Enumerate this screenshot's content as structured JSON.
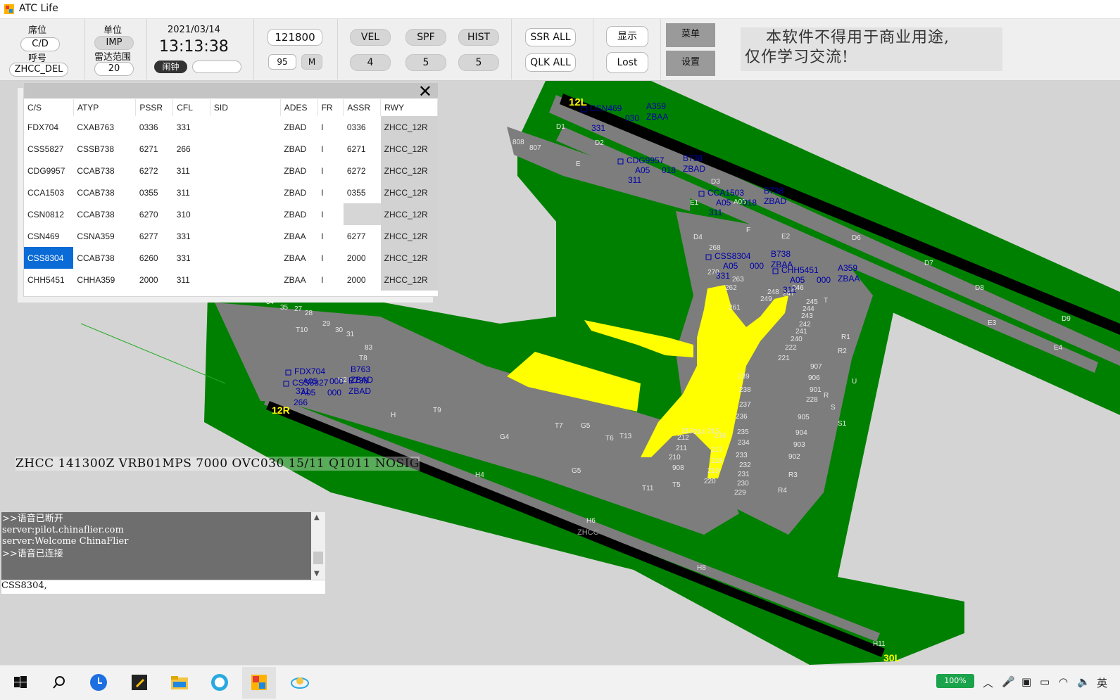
{
  "window": {
    "title": "ATC Life"
  },
  "toolbar": {
    "seat_label": "席位",
    "seat_value": "C/D",
    "callsign_label": "呼号",
    "callsign_value": "ZHCC_DEL",
    "unit_label": "单位",
    "unit_value": "IMP",
    "radar_range_label": "雷达范围",
    "radar_range_value": "20",
    "date": "2021/03/14",
    "time": "13:13:38",
    "alarm_label": "闹钟",
    "freq": "121800",
    "sub_value": "95",
    "m_label": "M",
    "vel_label": "VEL",
    "vel_value": "4",
    "spf_label": "SPF",
    "spf_value": "5",
    "hist_label": "HIST",
    "hist_value": "5",
    "ssr_all": "SSR ALL",
    "qlk_all": "QLK ALL",
    "display_label": "显示",
    "lost_label": "Lost",
    "menu_label": "菜单",
    "settings_label": "设置",
    "notice_line1": "本软件不得用于商业用途,",
    "notice_line2": "仅作学习交流!"
  },
  "flight_list": {
    "columns": [
      "C/S",
      "ATYP",
      "PSSR",
      "CFL",
      "SID",
      "ADES",
      "FR",
      "ASSR",
      "RWY"
    ],
    "rows": [
      [
        "FDX704",
        "CXAB763",
        "0336",
        "331",
        "",
        "ZBAD",
        "I",
        "0336",
        "ZHCC_12R"
      ],
      [
        "CSS5827",
        "CSSB738",
        "6271",
        "266",
        "",
        "ZBAD",
        "I",
        "6271",
        "ZHCC_12R"
      ],
      [
        "CDG9957",
        "CCAB738",
        "6272",
        "311",
        "",
        "ZBAD",
        "I",
        "6272",
        "ZHCC_12R"
      ],
      [
        "CCA1503",
        "CCAB738",
        "0355",
        "311",
        "",
        "ZBAD",
        "I",
        "0355",
        "ZHCC_12R"
      ],
      [
        "CSN0812",
        "CCAB738",
        "6270",
        "310",
        "",
        "ZBAD",
        "I",
        "",
        "ZHCC_12R"
      ],
      [
        "CSN469",
        "CSNA359",
        "6277",
        "331",
        "",
        "ZBAA",
        "I",
        "6277",
        "ZHCC_12R"
      ],
      [
        "CSS8304",
        "CCAB738",
        "6260",
        "331",
        "",
        "ZBAA",
        "I",
        "2000",
        "ZHCC_12R"
      ],
      [
        "CHH5451",
        "CHHA359",
        "2000",
        "311",
        "",
        "ZBAA",
        "I",
        "2000",
        "ZHCC_12R"
      ]
    ],
    "selected_row": 6
  },
  "map": {
    "runways": [
      "12L",
      "12R",
      "30L"
    ],
    "airport": "ZHCC",
    "labels": [
      "D1",
      "D2",
      "D3",
      "D4",
      "D6",
      "D7",
      "D8",
      "D9",
      "E",
      "E1",
      "E2",
      "E3",
      "E4",
      "F",
      "R",
      "R1",
      "R2",
      "R3",
      "R4",
      "S",
      "S1",
      "U",
      "T",
      "T6",
      "T7",
      "T8",
      "T9",
      "T10",
      "T11",
      "T13",
      "T5",
      "H",
      "H2",
      "H4",
      "H6",
      "H8",
      "H11",
      "G4",
      "G5",
      "G5",
      "A05",
      "808",
      "807",
      "27",
      "28",
      "29",
      "30",
      "31",
      "33",
      "34",
      "35",
      "83",
      "261",
      "262",
      "263",
      "268",
      "270",
      "239",
      "238",
      "237",
      "236",
      "235",
      "234",
      "233",
      "232",
      "231",
      "230",
      "229",
      "228",
      "905",
      "904",
      "903",
      "902",
      "901",
      "906",
      "907",
      "908",
      "210",
      "211",
      "212",
      "213",
      "214",
      "215",
      "216",
      "217",
      "218",
      "219",
      "220",
      "221",
      "222",
      "240",
      "241",
      "242",
      "243",
      "244",
      "245",
      "246",
      "247",
      "248",
      "249",
      "250",
      "251"
    ],
    "tags": [
      {
        "cs": "CSN469",
        "type": "A359",
        "alt": "331",
        "spd": "030",
        "dest": "ZBAA"
      },
      {
        "cs": "CDG9957",
        "type": "B738",
        "alt": "311",
        "spd": "018",
        "dest": "ZBAD",
        "gate": "A05"
      },
      {
        "cs": "CCA1503",
        "type": "B738",
        "alt": "311",
        "spd": "018",
        "dest": "ZBAD",
        "gate": "A05"
      },
      {
        "cs": "CSS8304",
        "type": "B738",
        "alt": "331",
        "spd": "000",
        "dest": "ZBAA",
        "gate": "A05"
      },
      {
        "cs": "CHH5451",
        "type": "A359",
        "alt": "311",
        "spd": "000",
        "dest": "ZBAA",
        "gate": "A05"
      },
      {
        "cs": "FDX704",
        "type": "B763",
        "alt": "331",
        "spd": "000",
        "dest": "ZBAD",
        "gate": "A05"
      },
      {
        "cs": "CSS5827",
        "type": "B738",
        "alt": "266",
        "spd": "000",
        "dest": "ZBAD",
        "gate": "A05"
      }
    ]
  },
  "metar": "ZHCC 141300Z VRB01MPS 7000 OVC030 15/11 Q1011 NOSIG",
  "console": {
    "lines": [
      ">>语音已断开",
      "server:pilot.chinaflier.com",
      "server:Welcome ChinaFlier",
      ">>语音已连接"
    ],
    "input": "CSS8304,"
  },
  "taskbar": {
    "battery": "100%",
    "ime": "英"
  },
  "colors": {
    "grass": "#008000",
    "apron": "#7d7d7d",
    "terminal": "#ffff00",
    "runway": "#000000",
    "background": "#d4d4d4",
    "tag": "#0000aa"
  }
}
